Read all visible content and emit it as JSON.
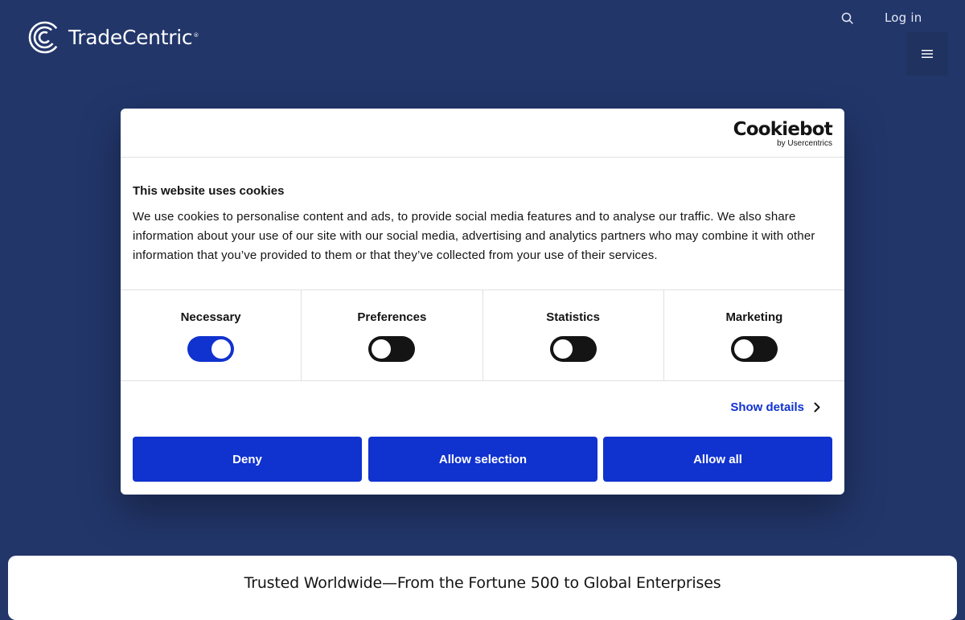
{
  "header": {
    "brand_name": "TradeCentric",
    "brand_mark": "®",
    "login_label": "Log in",
    "search_icon": "search-icon",
    "menu_icon": "hamburger-menu-icon"
  },
  "cookie_dialog": {
    "provider_name": "Cookiebot",
    "provider_by": "by Usercentrics",
    "title": "This website uses cookies",
    "body": "We use cookies to personalise content and ads, to provide social media features and to analyse our traffic. We also share information about your use of our site with our social media, advertising and analytics partners who may combine it with other information that you’ve provided to them or that they’ve collected from your use of their services.",
    "categories": [
      {
        "label": "Necessary",
        "checked": true
      },
      {
        "label": "Preferences",
        "checked": false
      },
      {
        "label": "Statistics",
        "checked": false
      },
      {
        "label": "Marketing",
        "checked": false
      }
    ],
    "show_details_label": "Show details",
    "buttons": {
      "deny": "Deny",
      "allow_selection": "Allow selection",
      "allow_all": "Allow all"
    }
  },
  "main": {
    "trusted_heading": "Trusted Worldwide—From the Fortune 500 to Global Enterprises"
  },
  "colors": {
    "page_background": "#22366a",
    "accent": "#1032cf",
    "toggle_off": "#141414",
    "text": "#141414"
  }
}
